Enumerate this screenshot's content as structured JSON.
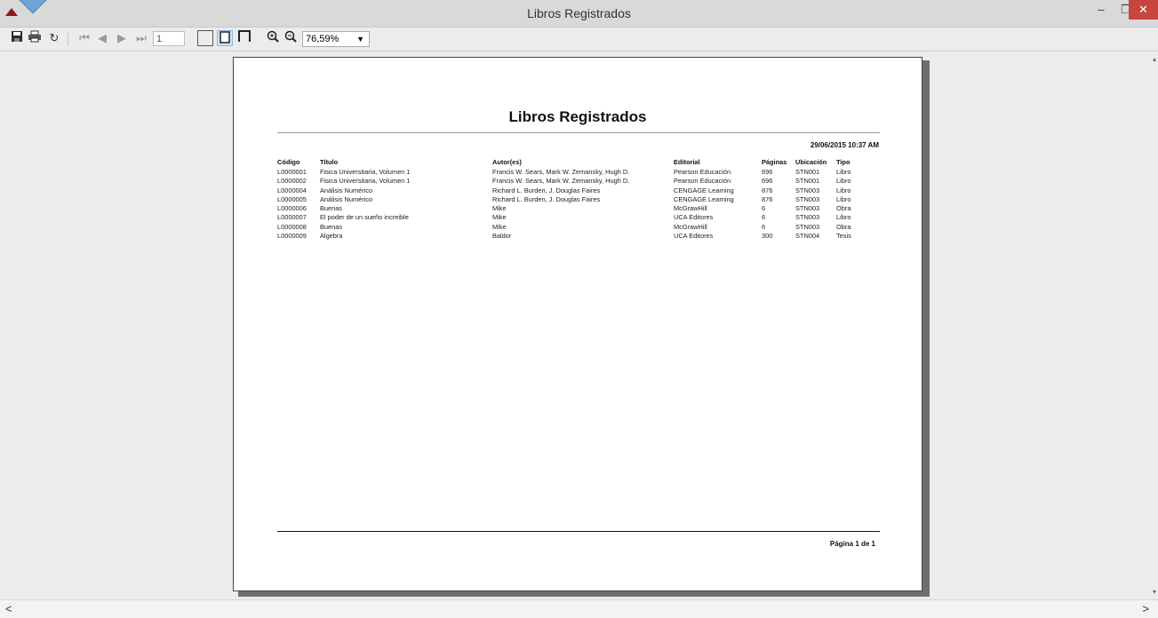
{
  "window": {
    "title": "Libros Registrados",
    "minimize": "‒",
    "maximize": "❐",
    "close": "✕"
  },
  "toolbar": {
    "page_number": "1",
    "zoom": "76,59%",
    "icons": [
      "save-icon",
      "print-icon",
      "refresh-icon",
      "first-page-icon",
      "prev-page-icon",
      "next-page-icon",
      "last-page-icon",
      "single-page-icon",
      "page-width-icon",
      "full-page-icon",
      "zoom-in-icon",
      "zoom-out-icon"
    ]
  },
  "report": {
    "title": "Libros Registrados",
    "datetime": "29/06/2015 10:37 AM",
    "columns": [
      "Código",
      "Título",
      "Autor(es)",
      "Editorial",
      "Páginas",
      "Ubicación",
      "Tipo"
    ],
    "rows": [
      [
        "L0000001",
        "Fisica Universitaria, Volumen 1",
        "Francis W. Sears, Mark W. Zemansky, Hugh D.",
        "Pearson Educación",
        "696",
        "STN001",
        "Libro"
      ],
      [
        "L0000002",
        "Fisica Universitaria, Volumen 1",
        "Francis W. Sears, Mark W. Zemansky, Hugh D.",
        "Pearson Educación",
        "696",
        "STN001",
        "Libro"
      ],
      [
        "L0000004",
        "Análisis Numérico",
        "Richard L. Burden, J. Douglas Faires",
        "CENGAGE Learning",
        "876",
        "STN003",
        "Libro"
      ],
      [
        "L0000005",
        "Análisis Numérico",
        "Richard L. Burden, J. Douglas Faires",
        "CENGAGE Learning",
        "876",
        "STN003",
        "Libro"
      ],
      [
        "L0000006",
        "Buenas",
        "Mike",
        "McGrawHill",
        "6",
        "STN003",
        "Obra"
      ],
      [
        "L0000007",
        "El poder de un sueño increible",
        "Mike",
        "UCA Editores",
        "6",
        "STN003",
        "Libro"
      ],
      [
        "L0000008",
        "Buenas",
        "Mike",
        "McGrawHill",
        "6",
        "STN003",
        "Obra"
      ],
      [
        "L0000009",
        "Algebra",
        "Baldor",
        "UCA Editores",
        "300",
        "STN004",
        "Tesis"
      ]
    ],
    "footer": "Página 1 de 1"
  },
  "scroll": {
    "left": "<",
    "right": ">"
  }
}
